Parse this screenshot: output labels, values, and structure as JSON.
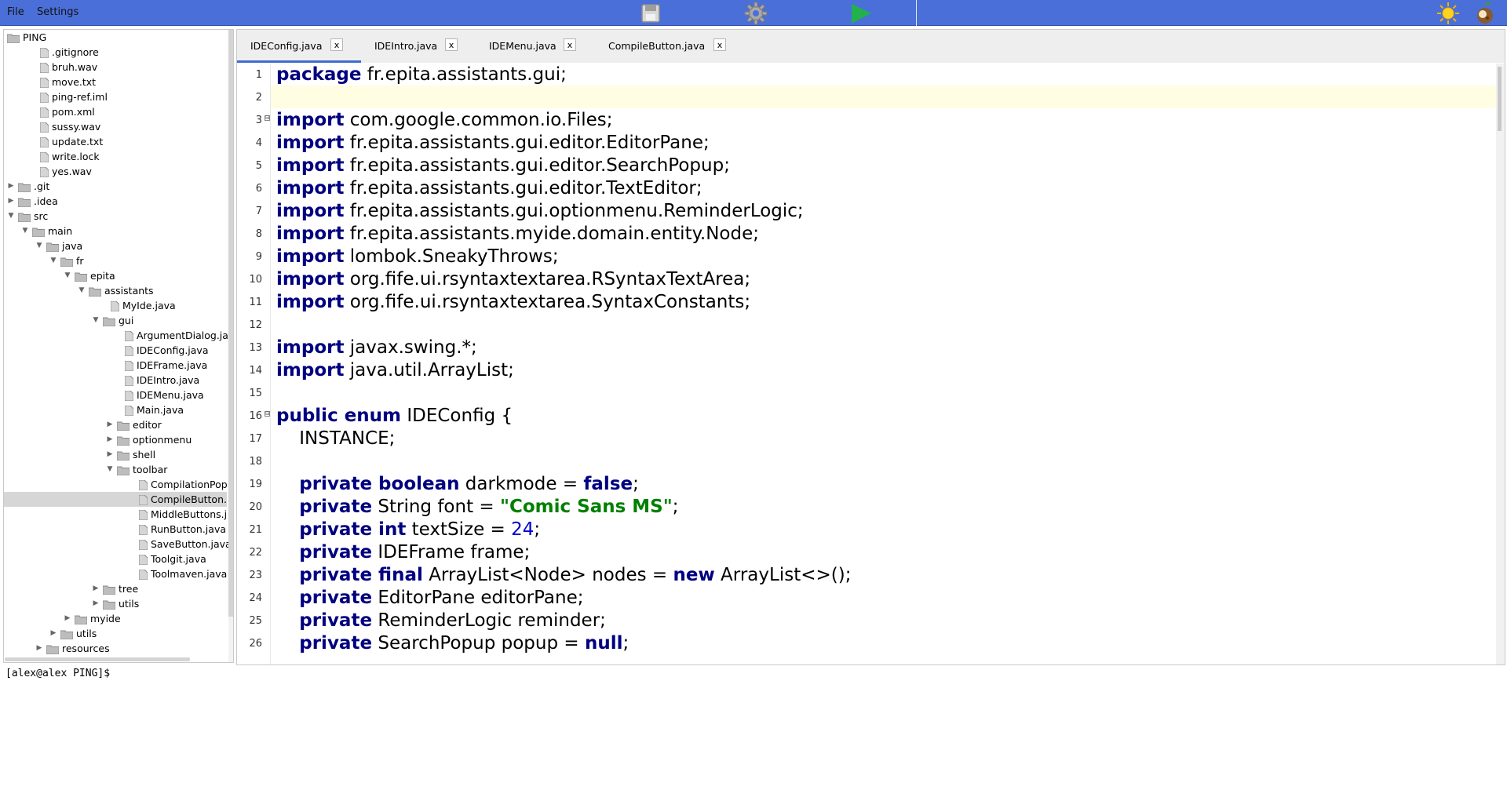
{
  "menu": {
    "file": "File",
    "settings": "Settings"
  },
  "toolbar": {
    "save_icon": "save-icon",
    "settings_icon": "gear-icon",
    "run_icon": "play-icon",
    "theme_icon": "sun-icon",
    "coconut_icon": "coconut-icon"
  },
  "tree": {
    "items": [
      {
        "label": "PING",
        "type": "root"
      },
      {
        "label": ".gitignore",
        "type": "file"
      },
      {
        "label": "bruh.wav",
        "type": "file"
      },
      {
        "label": "move.txt",
        "type": "file"
      },
      {
        "label": "ping-ref.iml",
        "type": "file"
      },
      {
        "label": "pom.xml",
        "type": "file"
      },
      {
        "label": "sussy.wav",
        "type": "file"
      },
      {
        "label": "update.txt",
        "type": "file"
      },
      {
        "label": "write.lock",
        "type": "file"
      },
      {
        "label": "yes.wav",
        "type": "file"
      },
      {
        "label": ".git",
        "type": "folder-collapsed"
      },
      {
        "label": ".idea",
        "type": "folder-collapsed"
      },
      {
        "label": "src",
        "type": "folder-expanded"
      },
      {
        "label": "main",
        "type": "folder-expanded"
      },
      {
        "label": "java",
        "type": "folder-expanded"
      },
      {
        "label": "fr",
        "type": "folder-expanded"
      },
      {
        "label": "epita",
        "type": "folder-expanded"
      },
      {
        "label": "assistants",
        "type": "folder-expanded"
      },
      {
        "label": "MyIde.java",
        "type": "file"
      },
      {
        "label": "gui",
        "type": "folder-expanded"
      },
      {
        "label": "ArgumentDialog.ja",
        "type": "file"
      },
      {
        "label": "IDEConfig.java",
        "type": "file"
      },
      {
        "label": "IDEFrame.java",
        "type": "file"
      },
      {
        "label": "IDEIntro.java",
        "type": "file"
      },
      {
        "label": "IDEMenu.java",
        "type": "file"
      },
      {
        "label": "Main.java",
        "type": "file"
      },
      {
        "label": "editor",
        "type": "folder-collapsed"
      },
      {
        "label": "optionmenu",
        "type": "folder-collapsed"
      },
      {
        "label": "shell",
        "type": "folder-collapsed"
      },
      {
        "label": "toolbar",
        "type": "folder-expanded"
      },
      {
        "label": "CompilationPop",
        "type": "file"
      },
      {
        "label": "CompileButton.",
        "type": "file",
        "selected": true
      },
      {
        "label": "MiddleButtons.j",
        "type": "file"
      },
      {
        "label": "RunButton.java",
        "type": "file"
      },
      {
        "label": "SaveButton.java",
        "type": "file"
      },
      {
        "label": "Toolgit.java",
        "type": "file"
      },
      {
        "label": "Toolmaven.java",
        "type": "file"
      },
      {
        "label": "tree",
        "type": "folder-collapsed"
      },
      {
        "label": "utils",
        "type": "folder-collapsed"
      },
      {
        "label": "myide",
        "type": "folder-collapsed"
      },
      {
        "label": "utils",
        "type": "folder-collapsed"
      },
      {
        "label": "resources",
        "type": "folder-collapsed"
      }
    ]
  },
  "tabs": [
    {
      "label": "IDEConfig.java",
      "active": true
    },
    {
      "label": "IDEIntro.java",
      "active": false
    },
    {
      "label": "IDEMenu.java",
      "active": false
    },
    {
      "label": "CompileButton.java",
      "active": false
    }
  ],
  "tab_close_label": "x",
  "editor": {
    "lines": [
      [
        [
          "kw",
          "package"
        ],
        [
          "t",
          " fr.epita.assistants.gui;"
        ]
      ],
      [],
      [
        [
          "kw",
          "import"
        ],
        [
          "t",
          " com.google.common.io.Files;"
        ]
      ],
      [
        [
          "kw",
          "import"
        ],
        [
          "t",
          " fr.epita.assistants.gui.editor.EditorPane;"
        ]
      ],
      [
        [
          "kw",
          "import"
        ],
        [
          "t",
          " fr.epita.assistants.gui.editor.SearchPopup;"
        ]
      ],
      [
        [
          "kw",
          "import"
        ],
        [
          "t",
          " fr.epita.assistants.gui.editor.TextEditor;"
        ]
      ],
      [
        [
          "kw",
          "import"
        ],
        [
          "t",
          " fr.epita.assistants.gui.optionmenu.ReminderLogic;"
        ]
      ],
      [
        [
          "kw",
          "import"
        ],
        [
          "t",
          " fr.epita.assistants.myide.domain.entity.Node;"
        ]
      ],
      [
        [
          "kw",
          "import"
        ],
        [
          "t",
          " lombok.SneakyThrows;"
        ]
      ],
      [
        [
          "kw",
          "import"
        ],
        [
          "t",
          " org.fife.ui.rsyntaxtextarea.RSyntaxTextArea;"
        ]
      ],
      [
        [
          "kw",
          "import"
        ],
        [
          "t",
          " org.fife.ui.rsyntaxtextarea.SyntaxConstants;"
        ]
      ],
      [],
      [
        [
          "kw",
          "import"
        ],
        [
          "t",
          " javax.swing.*;"
        ]
      ],
      [
        [
          "kw",
          "import"
        ],
        [
          "t",
          " java.util.ArrayList;"
        ]
      ],
      [],
      [
        [
          "kw",
          "public enum"
        ],
        [
          "t",
          " IDEConfig {"
        ]
      ],
      [
        [
          "t",
          "    INSTANCE;"
        ]
      ],
      [],
      [
        [
          "t",
          "    "
        ],
        [
          "kw",
          "private boolean"
        ],
        [
          "t",
          " darkmode = "
        ],
        [
          "kw",
          "false"
        ],
        [
          "t",
          ";"
        ]
      ],
      [
        [
          "t",
          "    "
        ],
        [
          "kw",
          "private"
        ],
        [
          "t",
          " String font = "
        ],
        [
          "str",
          "\"Comic Sans MS\""
        ],
        [
          "t",
          ";"
        ]
      ],
      [
        [
          "t",
          "    "
        ],
        [
          "kw",
          "private int"
        ],
        [
          "t",
          " textSize = "
        ],
        [
          "num",
          "24"
        ],
        [
          "t",
          ";"
        ]
      ],
      [
        [
          "t",
          "    "
        ],
        [
          "kw",
          "private"
        ],
        [
          "t",
          " IDEFrame frame;"
        ]
      ],
      [
        [
          "t",
          "    "
        ],
        [
          "kw",
          "private final"
        ],
        [
          "t",
          " ArrayList<Node> nodes = "
        ],
        [
          "kw",
          "new"
        ],
        [
          "t",
          " ArrayList<>();"
        ]
      ],
      [
        [
          "t",
          "    "
        ],
        [
          "kw",
          "private"
        ],
        [
          "t",
          " EditorPane editorPane;"
        ]
      ],
      [
        [
          "t",
          "    "
        ],
        [
          "kw",
          "private"
        ],
        [
          "t",
          " ReminderLogic reminder;"
        ]
      ],
      [
        [
          "t",
          "    "
        ],
        [
          "kw",
          "private"
        ],
        [
          "t",
          " SearchPopup popup = "
        ],
        [
          "kw",
          "null"
        ],
        [
          "t",
          ";"
        ]
      ]
    ],
    "fold_lines": [
      3,
      16
    ],
    "fold_mark": "⊟",
    "current_line": 2
  },
  "terminal": {
    "prompt": "[alex@alex PING]$"
  },
  "colors": {
    "topbar": "#4a6fd8",
    "keyword": "#000080",
    "string": "#008000",
    "number": "#0000cc",
    "current_line": "#fffde2"
  }
}
